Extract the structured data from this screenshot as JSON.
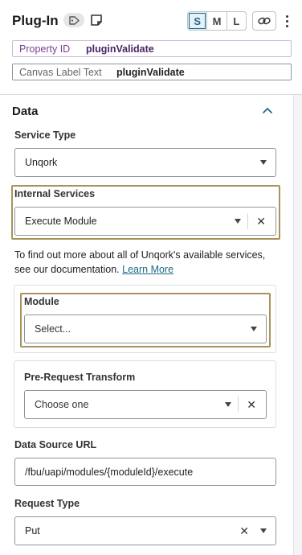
{
  "header": {
    "title": "Plug-In",
    "sizes": [
      "S",
      "M",
      "L"
    ],
    "active_size": "S"
  },
  "property_id": {
    "label": "Property ID",
    "value": "pluginValidate"
  },
  "canvas_label": {
    "label": "Canvas Label Text",
    "value": "pluginValidate"
  },
  "section": {
    "title": "Data"
  },
  "service_type": {
    "label": "Service Type",
    "value": "Unqork"
  },
  "internal_services": {
    "label": "Internal Services",
    "value": "Execute Module"
  },
  "info": {
    "text": "To find out more about all of Unqork's available services, see our documentation.",
    "link": "Learn More"
  },
  "module": {
    "label": "Module",
    "placeholder": "Select..."
  },
  "pre_request": {
    "label": "Pre-Request Transform",
    "placeholder": "Choose one"
  },
  "data_source": {
    "label": "Data Source URL",
    "value": "/fbu/uapi/modules/{moduleId}/execute"
  },
  "request_type": {
    "label": "Request Type",
    "value": "Put"
  },
  "colors": {
    "accent": "#1d6a86",
    "highlight": "#a8945a",
    "property_purple": "#7a3f96"
  }
}
